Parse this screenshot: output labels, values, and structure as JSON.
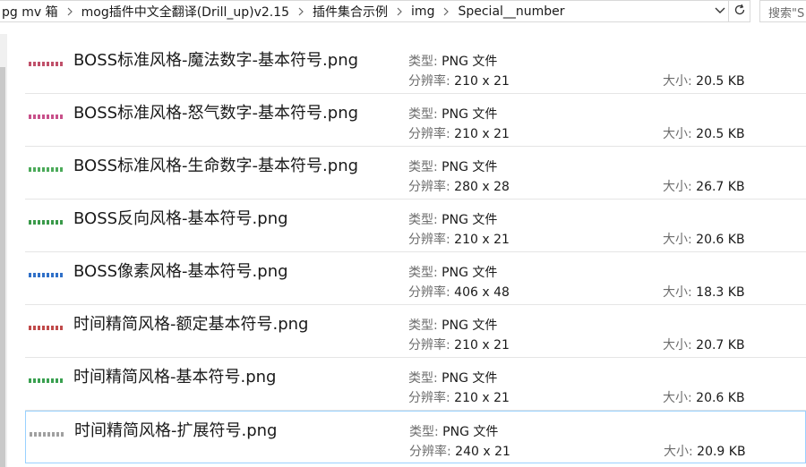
{
  "breadcrumb": [
    "pg mv 箱",
    "mog插件中文全翻译(Drill_up)v2.15",
    "插件集合示例",
    "img",
    "Special__number"
  ],
  "search": {
    "placeholder": "搜索\"S"
  },
  "labels": {
    "type": "类型: ",
    "resolution": "分辨率: ",
    "size": "大小: "
  },
  "files": [
    {
      "name": "BOSS标准风格-魔法数字-基本符号.png",
      "type": "PNG 文件",
      "resolution": "210 x 21",
      "size": "20.5 KB",
      "thumb_color": "#c0506a"
    },
    {
      "name": "BOSS标准风格-怒气数字-基本符号.png",
      "type": "PNG 文件",
      "resolution": "210 x 21",
      "size": "20.5 KB",
      "thumb_color": "#c8508a"
    },
    {
      "name": "BOSS标准风格-生命数字-基本符号.png",
      "type": "PNG 文件",
      "resolution": "280 x 28",
      "size": "26.7 KB",
      "thumb_color": "#4caa5a"
    },
    {
      "name": "BOSS反向风格-基本符号.png",
      "type": "PNG 文件",
      "resolution": "210 x 21",
      "size": "20.6 KB",
      "thumb_color": "#3a9a4a"
    },
    {
      "name": "BOSS像素风格-基本符号.png",
      "type": "PNG 文件",
      "resolution": "406 x 48",
      "size": "18.3 KB",
      "thumb_color": "#3070c8"
    },
    {
      "name": "时间精简风格-额定基本符号.png",
      "type": "PNG 文件",
      "resolution": "210 x 21",
      "size": "20.7 KB",
      "thumb_color": "#c04a4a"
    },
    {
      "name": "时间精简风格-基本符号.png",
      "type": "PNG 文件",
      "resolution": "210 x 21",
      "size": "20.6 KB",
      "thumb_color": "#3aa050"
    },
    {
      "name": "时间精简风格-扩展符号.png",
      "type": "PNG 文件",
      "resolution": "240 x 21",
      "size": "20.9 KB",
      "thumb_color": "#a0a0a0"
    }
  ]
}
